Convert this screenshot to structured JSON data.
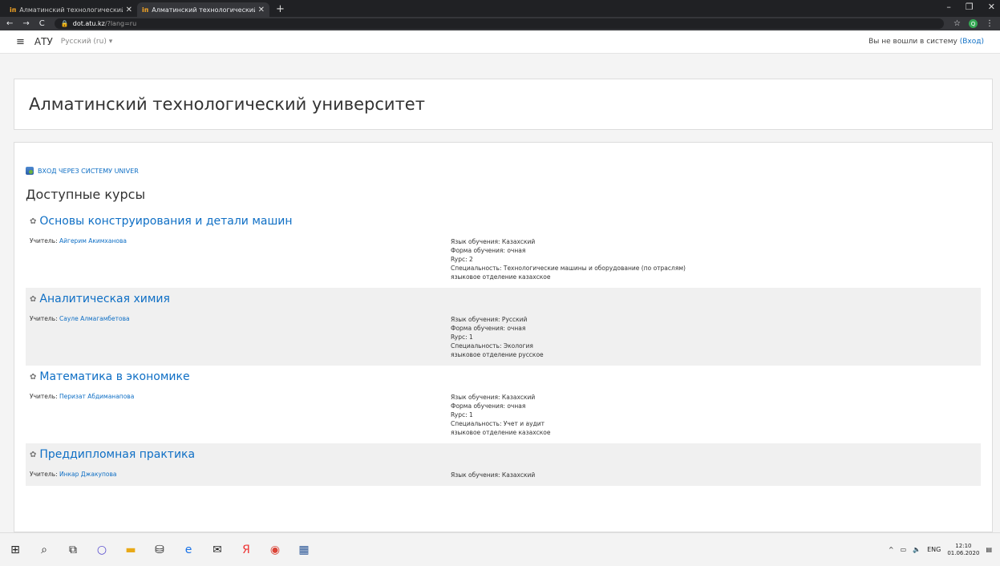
{
  "browser": {
    "tabs": [
      {
        "favicon": "iп",
        "title": "Алматинский технологический"
      },
      {
        "favicon": "iп",
        "title": "Алматинский технологический"
      }
    ],
    "new_tab": "+",
    "url_host": "dot.atu.kz",
    "url_path": "/?lang=ru",
    "profile_initial": "Q"
  },
  "navbar": {
    "brand": "АТУ",
    "language": "Русский (ru) ▾",
    "login_text": "Вы не вошли в систему",
    "login_link": "(Вход)"
  },
  "header": {
    "title": "Алматинский технологический университет"
  },
  "main": {
    "univer_link": "ВХОД ЧЕРЕЗ СИСТЕМУ UNIVER",
    "section_title": "Доступные курсы",
    "courses": [
      {
        "name": "Основы конструирования и детали машин",
        "teacher_label": "Учитель:",
        "teacher": "Айгерим Акимханова",
        "summary": [
          "Язык обучения: Казахский",
          "Форма обучения: очная",
          "Rypc: 2",
          "Специальность: Технологические машины и оборудование (по отраслям)",
          "языковое отделение казахское"
        ]
      },
      {
        "name": "Аналитическая химия",
        "teacher_label": "Учитель:",
        "teacher": "Сауле Алмагамбетова",
        "summary": [
          "Язык обучения: Русский",
          "Форма обучения: очная",
          "Rypc: 1",
          "Специальность: Экология",
          "языковое отделение русское"
        ]
      },
      {
        "name": "Математика в экономике",
        "teacher_label": "Учитель:",
        "teacher": "Перизат Абдиманапова",
        "summary": [
          "Язык обучения: Казахский",
          "Форма обучения: очная",
          "Rypc: 1",
          "Специальность: Учет и аудит",
          "языковое отделение казахское"
        ]
      },
      {
        "name": "Преддипломная практика",
        "teacher_label": "Учитель:",
        "teacher": "Инкар Джакупова",
        "summary": [
          "Язык обучения: Казахский"
        ]
      }
    ]
  },
  "taskbar": {
    "lang": "ENG",
    "time": "12:10",
    "date": "01.06.2020"
  }
}
